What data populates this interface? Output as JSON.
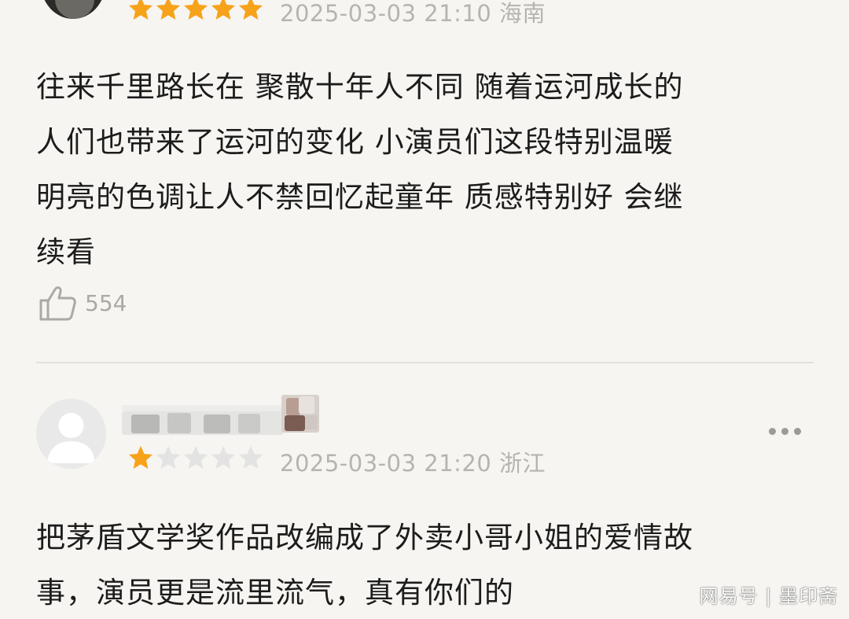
{
  "comments": [
    {
      "rating": 5,
      "timestamp": "2025-03-03 21:10",
      "location": "海南",
      "lines": [
        "往来千里路长在 聚散十年人不同 随着运河成长的",
        "人们也带来了运河的变化 小演员们这段特别温暖",
        "明亮的色调让人不禁回忆起童年 质感特别好 会继",
        "续看"
      ],
      "like_count": "554"
    },
    {
      "rating": 1,
      "timestamp": "2025-03-03 21:20",
      "location": "浙江",
      "lines": [
        "把茅盾文学奖作品改编成了外卖小哥小姐的爱情故",
        "事，演员更是流里流气，真有你们的"
      ]
    }
  ],
  "watermark": "网易号 | 墨印斋",
  "colors": {
    "star_filled": "#f7a21b",
    "star_empty": "#e3e3e3",
    "meta_text": "#b4b4b0",
    "body_text": "#1c1c1c",
    "background": "#f6f5f1"
  },
  "icons": {
    "like": "thumbs-up-icon",
    "more": "more-dots-icon",
    "avatar_default": "default-avatar-icon"
  }
}
